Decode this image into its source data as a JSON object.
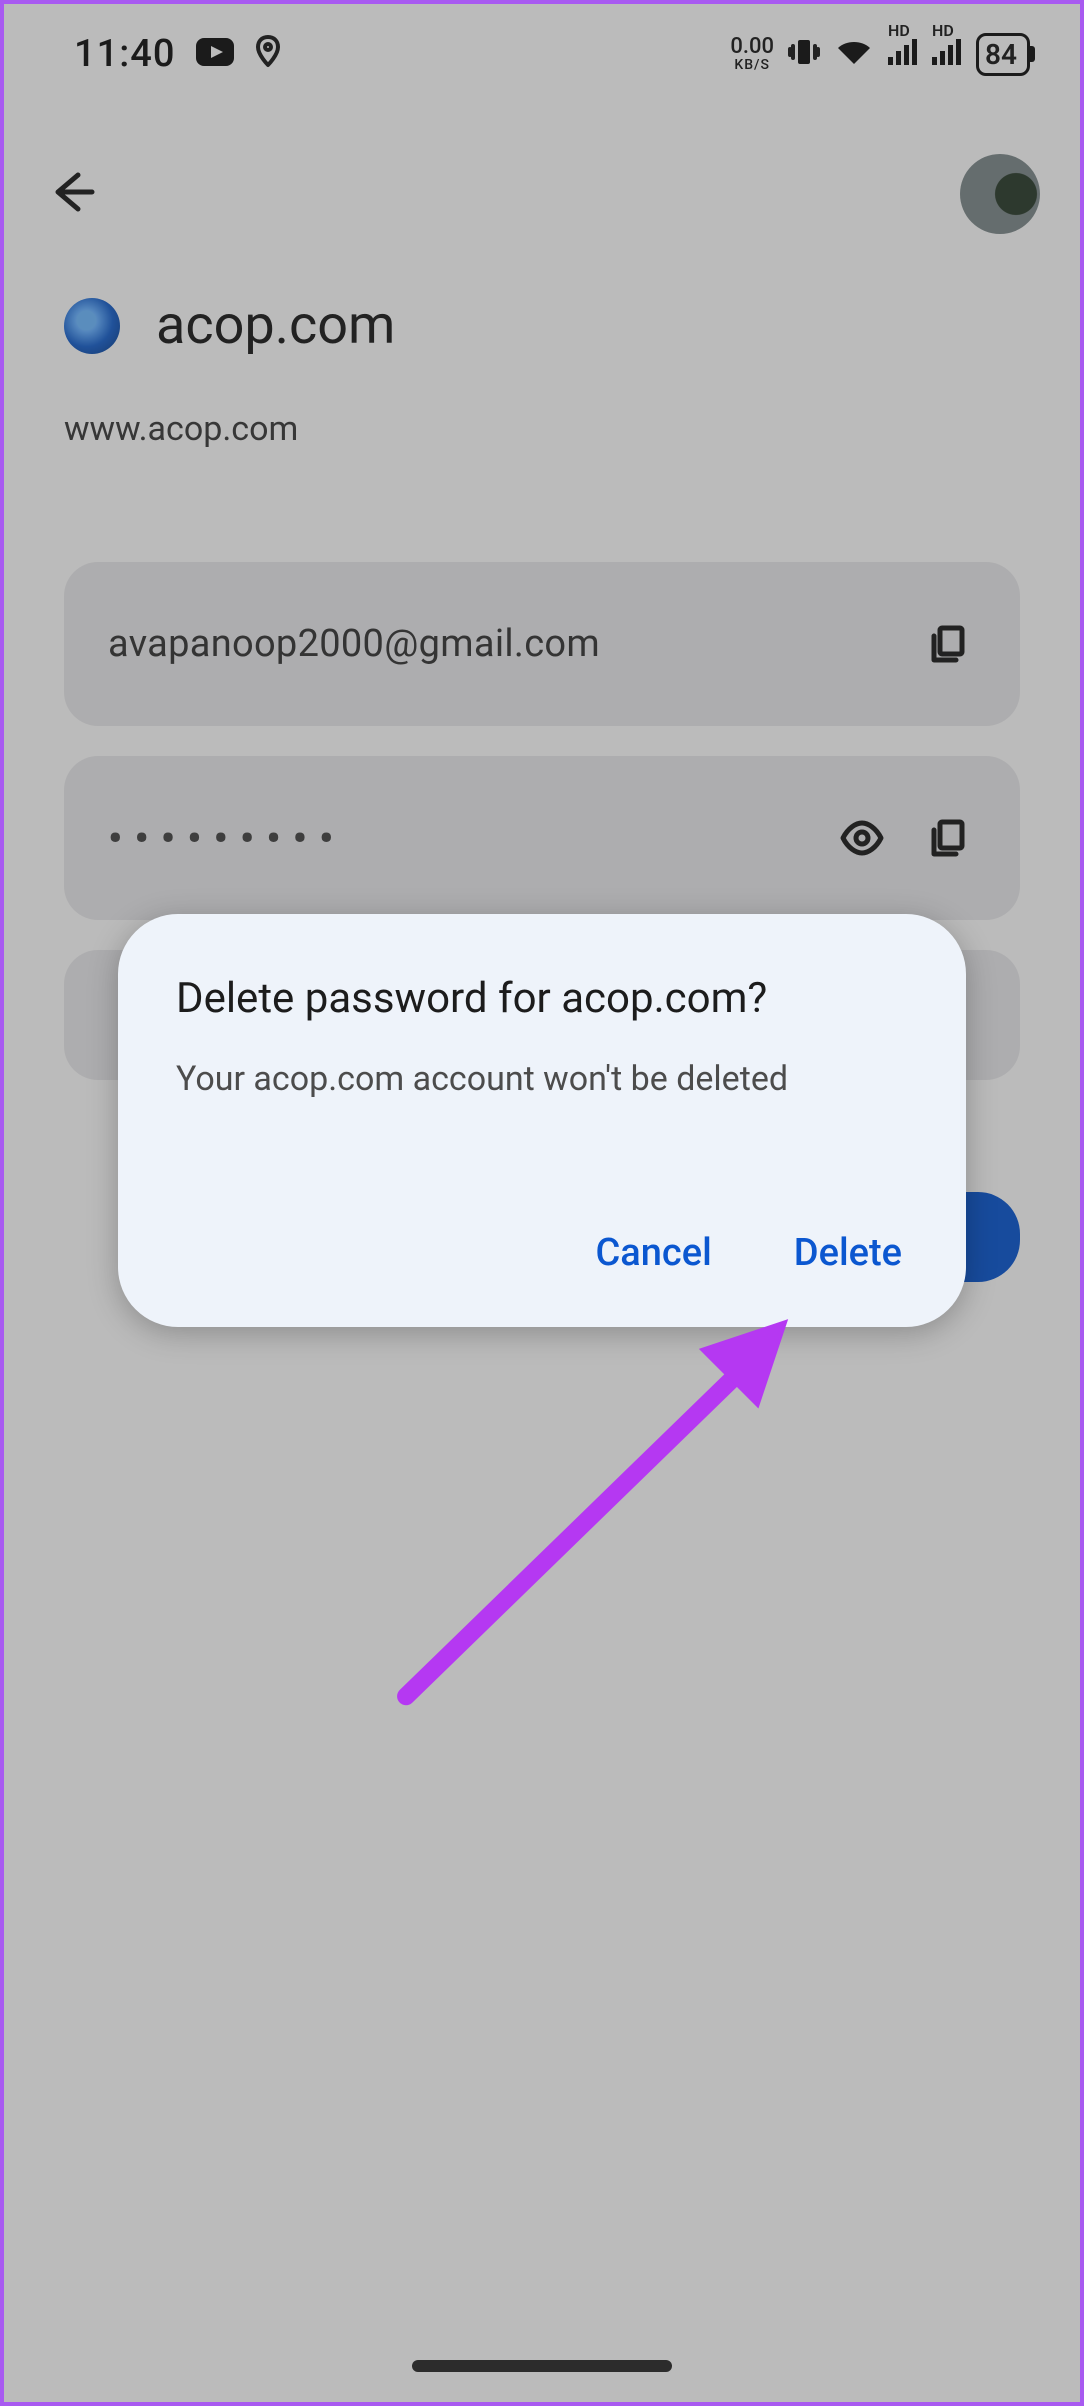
{
  "status_bar": {
    "time": "11:40",
    "net_speed_value": "0.00",
    "net_speed_unit": "KB/S",
    "hd_label": "HD",
    "battery_percent": "84"
  },
  "header": {},
  "site": {
    "title": "acop.com",
    "url": "www.acop.com"
  },
  "fields": {
    "username": "avapanoop2000@gmail.com",
    "password_mask": "•••••••••"
  },
  "dialog": {
    "title": "Delete password for acop.com?",
    "body": "Your acop.com account won't be deleted",
    "cancel_label": "Cancel",
    "delete_label": "Delete"
  }
}
